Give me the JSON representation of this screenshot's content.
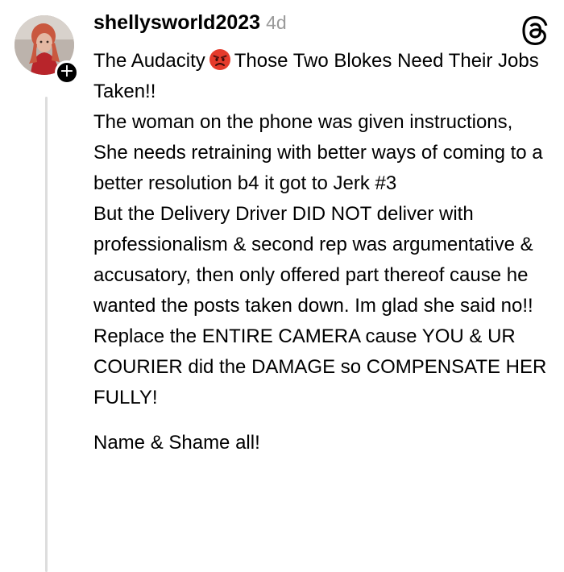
{
  "post": {
    "username": "shellysworld2023",
    "timestamp": "4d",
    "follow_symbol": "+",
    "icon_names": {
      "threads": "threads-logo-icon",
      "emoji": "angry-face-icon",
      "follow": "plus-icon"
    },
    "colors": {
      "text": "#000000",
      "muted": "#9a9a9a",
      "thread_line": "#dddddd",
      "emoji": "#e53b2c"
    },
    "paragraphs": [
      {
        "before_emoji": "The Audacity",
        "after_emoji": "Those Two Blokes Need Their Jobs Taken!!"
      },
      {
        "text": "The woman on the phone was given instructions,"
      },
      {
        "text": "She needs retraining with better ways of coming to a better resolution b4 it got to Jerk #3"
      },
      {
        "text": "But the Delivery Driver DID NOT deliver with professionalism & second rep was argumentative & accusatory, then only offered part thereof cause he wanted the posts taken down. Im glad she said no!!"
      },
      {
        "text": "Replace the ENTIRE CAMERA cause YOU & UR COURIER did the DAMAGE so COMPENSATE HER FULLY!"
      },
      {
        "text": "Name & Shame all!"
      }
    ]
  }
}
